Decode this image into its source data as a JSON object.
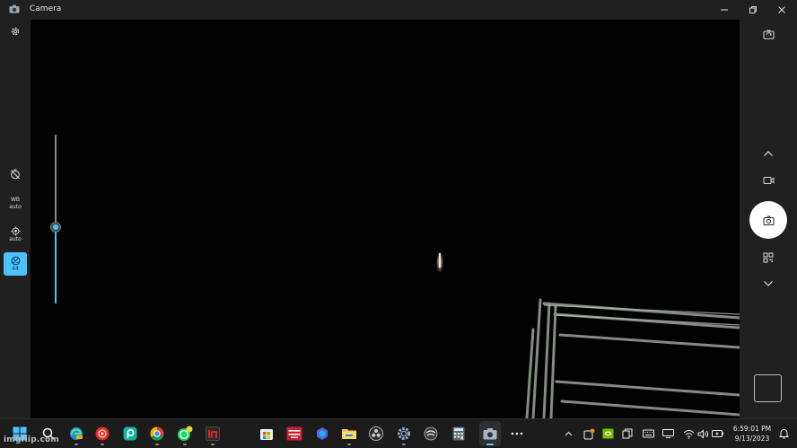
{
  "window": {
    "title": "Camera"
  },
  "left_rail": {
    "settings_icon": "gear-icon",
    "timer_icon": "timer-off-icon",
    "wb": {
      "line1": "WB",
      "line2": "auto"
    },
    "focus": {
      "label": "auto"
    },
    "exposure": {
      "value": "44"
    }
  },
  "exposure_slider": {
    "value_fraction": 0.45
  },
  "right_rail": {
    "icons": [
      "switch-camera-icon",
      "chevron-up-icon",
      "video-icon",
      "camera-shutter-icon",
      "qr-code-icon",
      "chevron-down-icon"
    ]
  },
  "taskbar": {
    "clock_time": "6:59:01 PM",
    "clock_date": "9/13/2023",
    "apps": [
      "start",
      "search",
      "edge",
      "youtube-music",
      "picsart",
      "chrome",
      "whatsapp",
      "screen-recorder",
      "store",
      "voice-meter",
      "copilot",
      "file-explorer",
      "obs",
      "settings",
      "network",
      "calculator",
      "camera",
      "more"
    ]
  },
  "watermark": "imgflip.com",
  "colors": {
    "accent": "#4cc2ff",
    "chrome": "#202020",
    "preview": "#020202"
  }
}
